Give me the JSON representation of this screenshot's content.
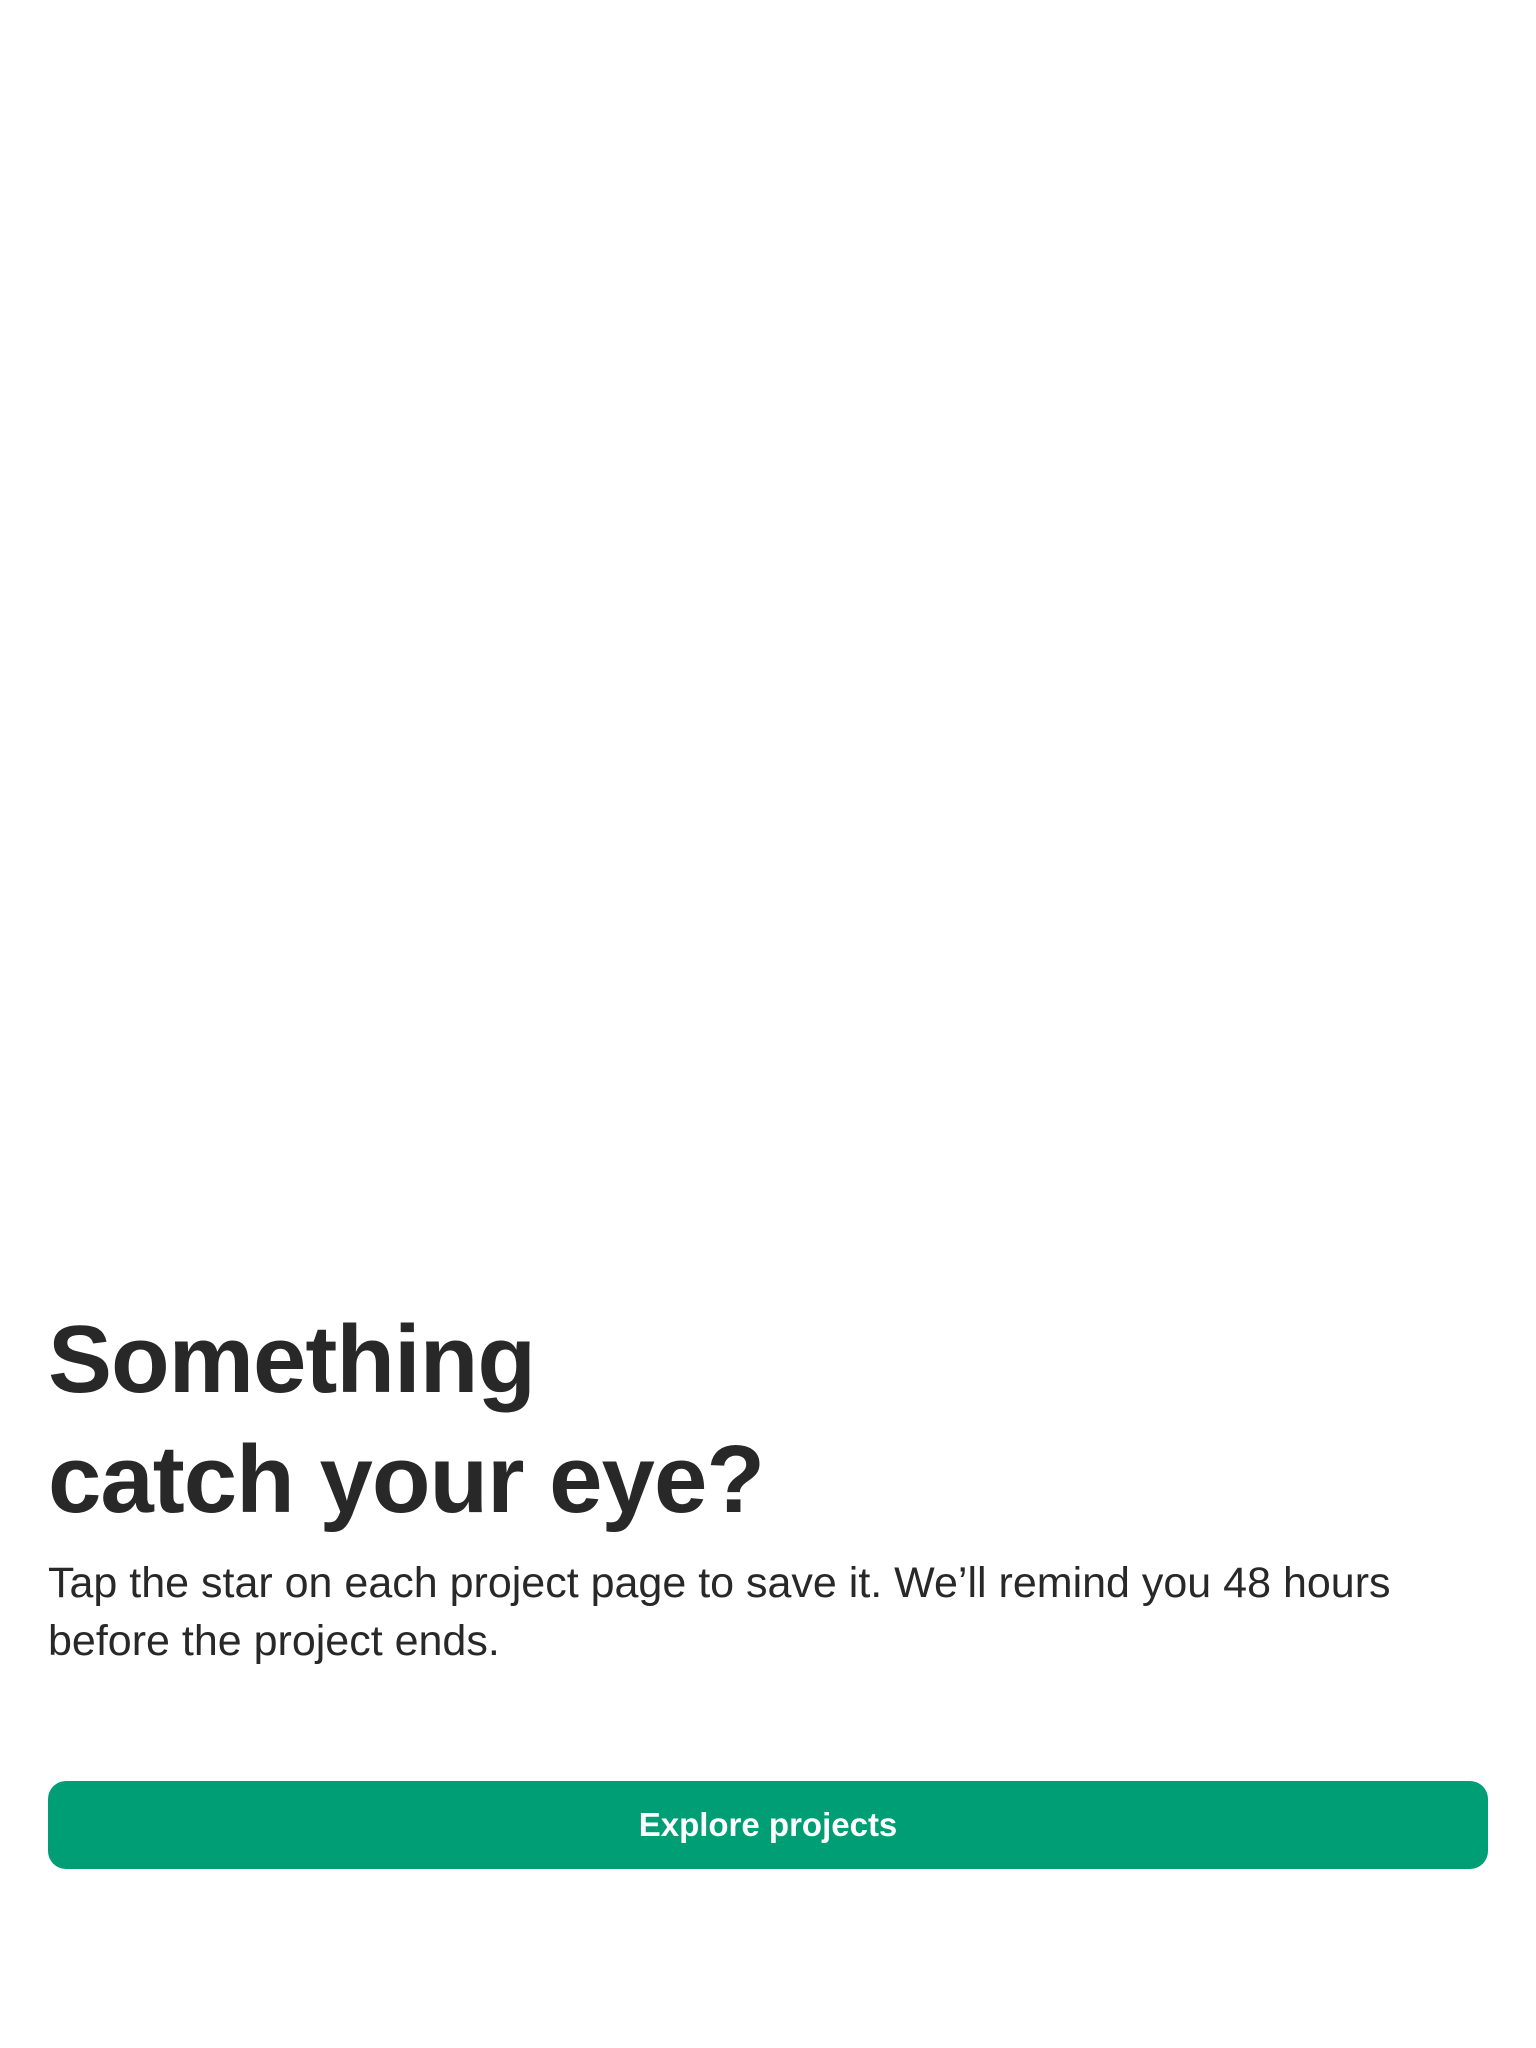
{
  "empty_state": {
    "headline_line1": "Something",
    "headline_line2": "catch your eye?",
    "body": "Tap the star on each project page to save it. We’ll remind you 48 hours before the project ends.",
    "cta_label": "Explore projects"
  },
  "colors": {
    "cta_background": "#009e74",
    "cta_text": "#ffffff",
    "text_primary": "#282828",
    "background": "#ffffff"
  }
}
